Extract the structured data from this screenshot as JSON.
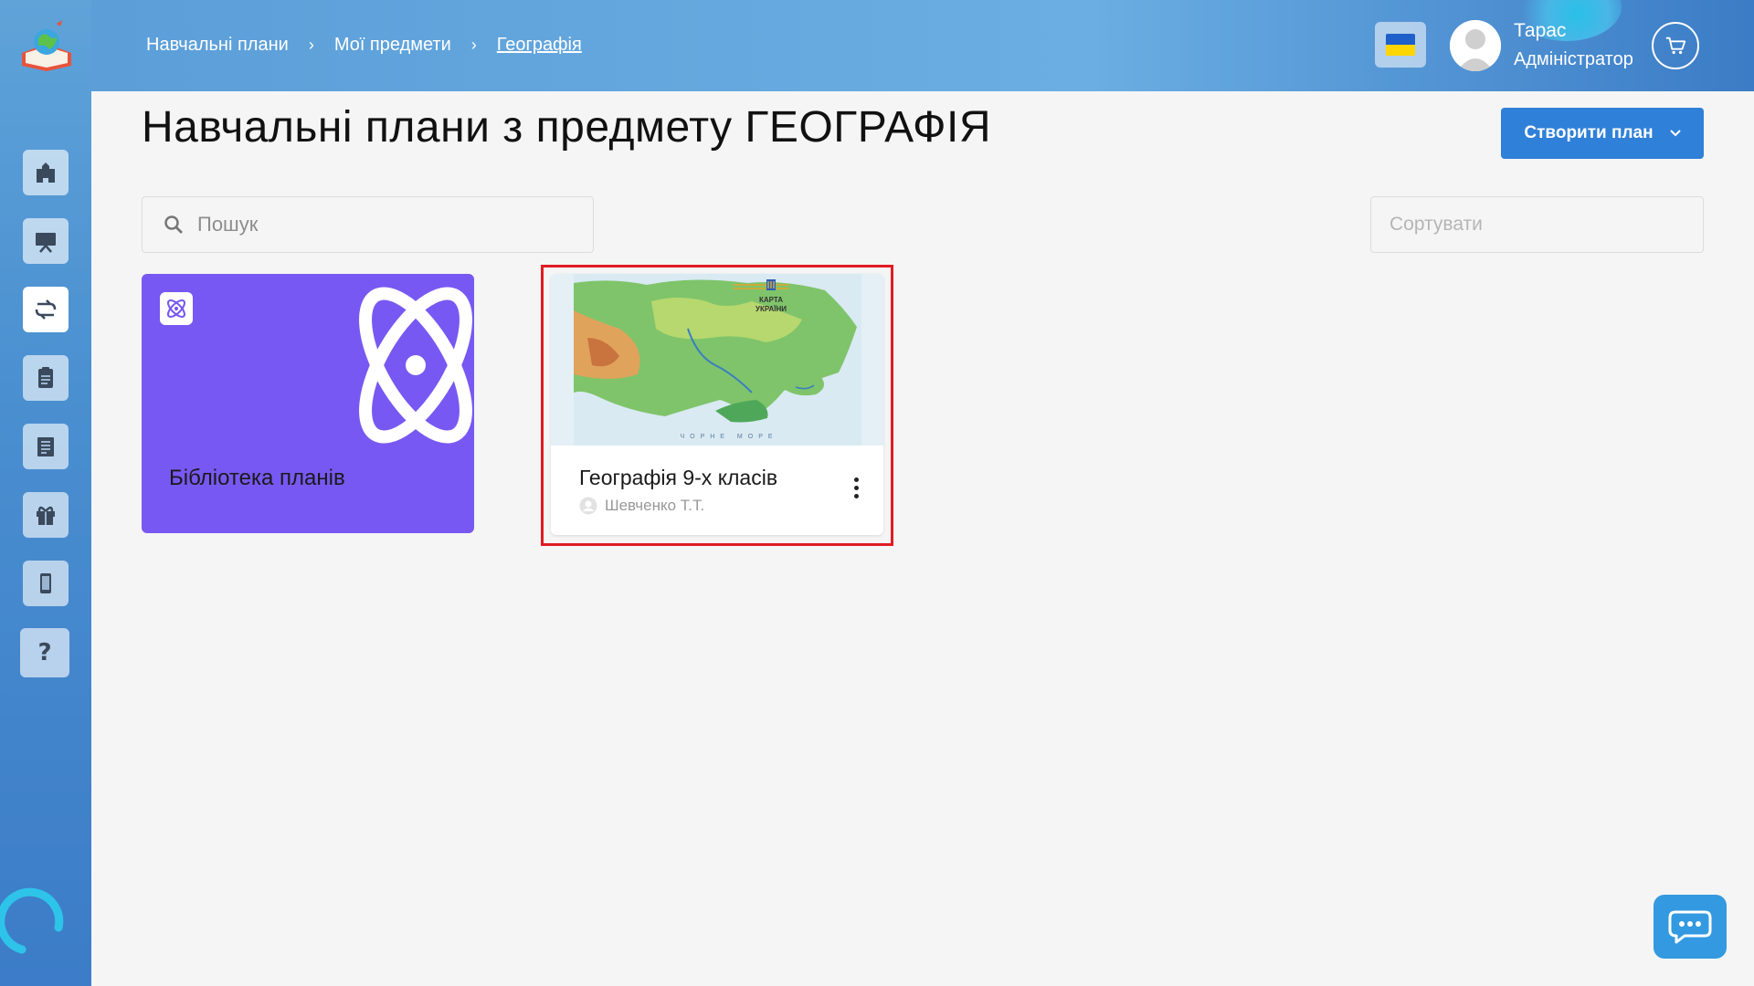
{
  "breadcrumb": [
    {
      "label": "Навчальні плани"
    },
    {
      "label": "Мої предмети"
    },
    {
      "label": "Географія"
    }
  ],
  "user": {
    "name": "Тарас",
    "role": "Адміністратор"
  },
  "page": {
    "title": "Навчальні плани з предмету ГЕОГРАФІЯ",
    "create_button": "Створити план"
  },
  "search": {
    "placeholder": "Пошук",
    "value": ""
  },
  "sort": {
    "placeholder": "Сортувати"
  },
  "library_card": {
    "title": "Бібліотека планів",
    "color": "#7858f2"
  },
  "plans": [
    {
      "title": "Географія 9-х класів",
      "author": "Шевченко Т.Т.",
      "map_label_line1": "КАРТА",
      "map_label_line2": "УКРАЇНИ",
      "sea_label": "ЧОРНЕ МОРЕ"
    }
  ],
  "sidebar": {
    "items": [
      {
        "icon": "school-icon"
      },
      {
        "icon": "presentation-icon"
      },
      {
        "icon": "route-icon",
        "active": true
      },
      {
        "icon": "clipboard-icon"
      },
      {
        "icon": "journal-icon"
      },
      {
        "icon": "gift-icon"
      },
      {
        "icon": "mobile-icon"
      }
    ],
    "help_label": "?"
  },
  "colors": {
    "primary": "#2f80d8",
    "highlight": "#e01b24",
    "sidebar": "#4a8fd0"
  }
}
